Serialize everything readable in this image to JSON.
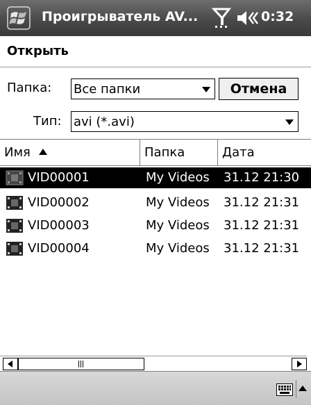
{
  "titlebar": {
    "app_title": "Проигрыватель AV...",
    "clock": "0:32"
  },
  "dialog": {
    "title": "Открыть",
    "folder_label": "Папка:",
    "folder_value": "Все папки",
    "cancel_label": "Отмена",
    "type_label": "Тип:",
    "type_value": "avi (*.avi)"
  },
  "list": {
    "columns": [
      "Имя",
      "Папка",
      "Дата"
    ],
    "sort_column": "Имя",
    "rows": [
      {
        "name": "VID00001",
        "folder": "My Videos",
        "date": "31.12 21:30",
        "selected": true
      },
      {
        "name": "VID00002",
        "folder": "My Videos",
        "date": "31.12 21:31",
        "selected": false
      },
      {
        "name": "VID00003",
        "folder": "My Videos",
        "date": "31.12 21:31",
        "selected": false
      },
      {
        "name": "VID00004",
        "folder": "My Videos",
        "date": "31.12 21:31",
        "selected": false
      }
    ]
  },
  "icons": {
    "start": "windows-flag-icon",
    "signal": "signal-antenna-icon",
    "volume": "speaker-volume-icon",
    "row": "video-clip-icon",
    "keyboard": "keyboard-icon"
  },
  "colors": {
    "titlebar": "#4a4a4a",
    "selection": "#000000",
    "bottombar": "#cfcfcf"
  }
}
